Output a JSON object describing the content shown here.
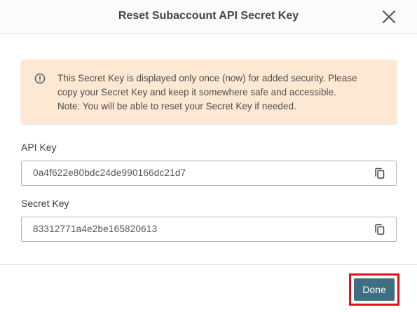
{
  "dialog": {
    "title": "Reset Subaccount API Secret Key",
    "close_icon": "close-icon"
  },
  "alert": {
    "icon": "info-circle-icon",
    "lines": [
      "This Secret Key is displayed only once (now) for added security. Please",
      "copy your Secret Key and keep it somewhere safe and accessible.",
      "Note: You will be able to reset your Secret Key if needed."
    ],
    "background_color": "#fde8d3"
  },
  "api_key": {
    "label": "API Key",
    "value": "0a4f622e80bdc24de990166dc21d7",
    "copy_icon": "copy-icon"
  },
  "secret_key": {
    "label": "Secret Key",
    "value": "83312771a4e2be165820613",
    "copy_icon": "copy-icon"
  },
  "footer": {
    "done_label": "Done",
    "done_color": "#3e6f80",
    "highlight_color": "#e0101a"
  }
}
